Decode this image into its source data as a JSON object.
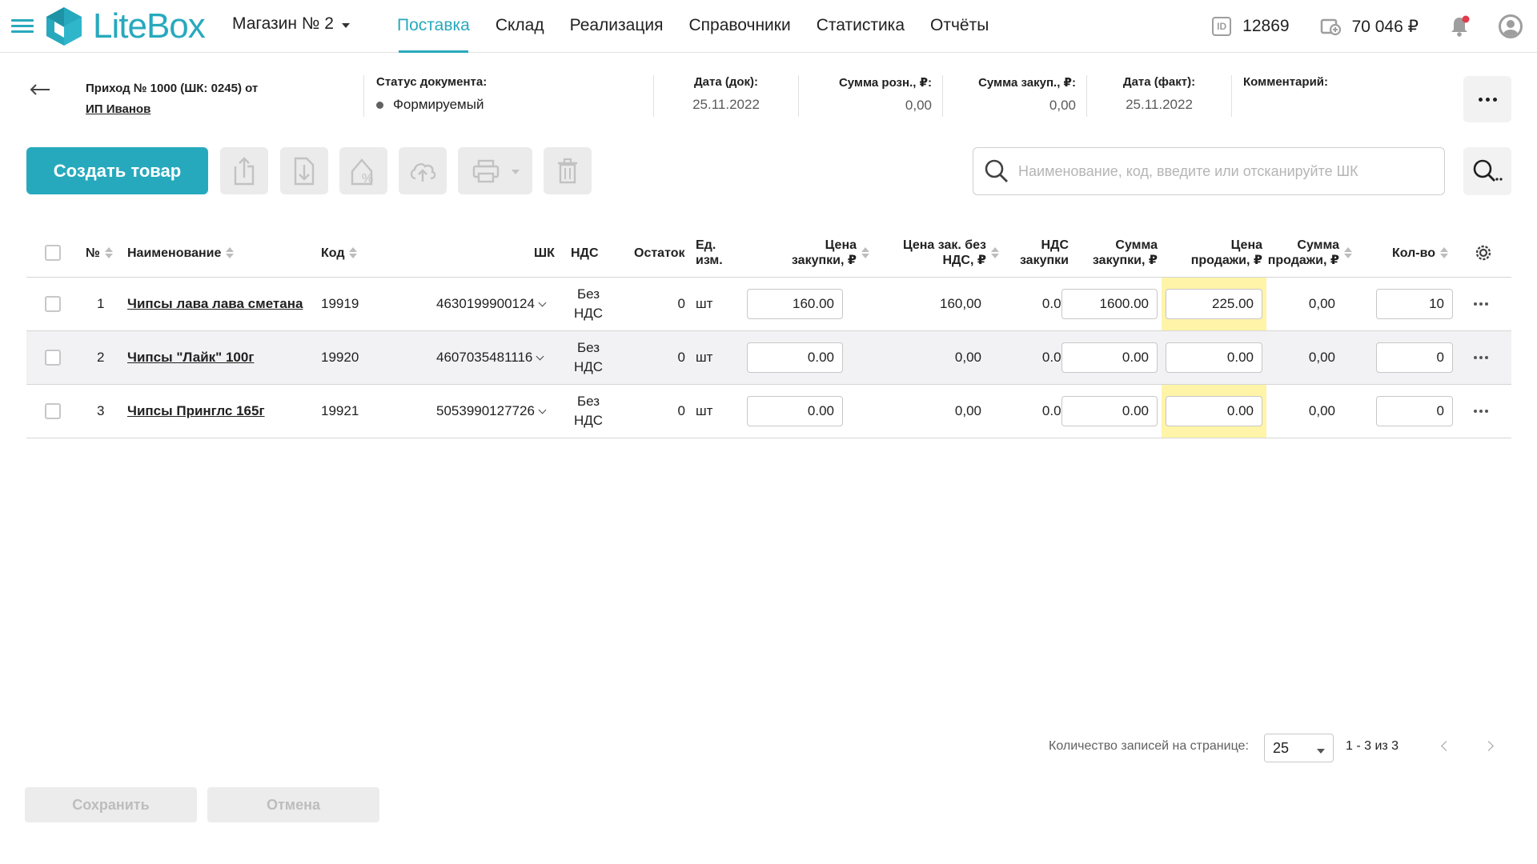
{
  "brand": {
    "name": "LiteBox",
    "color": "#27a9bd"
  },
  "store": {
    "label": "Магазин № 2"
  },
  "nav": [
    {
      "label": "Поставка",
      "active": true
    },
    {
      "label": "Склад"
    },
    {
      "label": "Реализация"
    },
    {
      "label": "Справочники"
    },
    {
      "label": "Статистика"
    },
    {
      "label": "Отчёты"
    }
  ],
  "account": {
    "id_value": "12869",
    "balance": "70 046 ₽",
    "id_icon_text": "ID"
  },
  "document": {
    "title": "Приход № 1000 (ШК: 0245) от",
    "supplier": "ИП Иванов",
    "status_label": "Статус документа:",
    "status_value": "Формируемый",
    "date_doc_label": "Дата (док):",
    "date_doc_value": "25.11.2022",
    "sum_retail_label": "Сумма розн., ₽:",
    "sum_retail_value": "0,00",
    "sum_purchase_label": "Сумма закуп., ₽:",
    "sum_purchase_value": "0,00",
    "date_fact_label": "Дата (факт):",
    "date_fact_value": "25.11.2022",
    "comment_label": "Комментарий:"
  },
  "toolbar": {
    "create_label": "Создать товар",
    "search_placeholder": "Наименование, код, введите или отсканируйте ШК"
  },
  "table": {
    "columns": {
      "num": "№",
      "name": "Наименование",
      "code": "Код",
      "barcode": "ШК",
      "vat": "НДС",
      "stock": "Остаток",
      "unit_1": "Ед.",
      "unit_2": "изм.",
      "purchase_price_1": "Цена",
      "purchase_price_2": "закупки, ₽",
      "price_no_vat_1": "Цена зак. без",
      "price_no_vat_2": "НДС, ₽",
      "vat_purchase_1": "НДС",
      "vat_purchase_2": "закупки",
      "purchase_sum_1": "Сумма",
      "purchase_sum_2": "закупки, ₽",
      "sale_price_1": "Цена",
      "sale_price_2": "продажи, ₽",
      "sale_sum_1": "Сумма",
      "sale_sum_2": "продажи, ₽",
      "qty": "Кол-во"
    },
    "rows": [
      {
        "num": "1",
        "name": "Чипсы лава лава сметана",
        "code": "19919",
        "barcode": "4630199900124",
        "vat_1": "Без",
        "vat_2": "НДС",
        "stock": "0",
        "unit": "шт",
        "purchase_price": "160.00",
        "price_no_vat": "160,00",
        "vat_purchase": "0.00",
        "purchase_sum": "1600.00",
        "sale_price": "225.00",
        "sale_sum": "0,00",
        "qty": "10"
      },
      {
        "num": "2",
        "name": "Чипсы \"Лайк\" 100г",
        "code": "19920",
        "barcode": "4607035481116",
        "vat_1": "Без",
        "vat_2": "НДС",
        "stock": "0",
        "unit": "шт",
        "purchase_price": "0.00",
        "price_no_vat": "0,00",
        "vat_purchase": "0.00",
        "purchase_sum": "0.00",
        "sale_price": "0.00",
        "sale_sum": "0,00",
        "qty": "0"
      },
      {
        "num": "3",
        "name": "Чипсы Принглс 165г",
        "code": "19921",
        "barcode": "5053990127726",
        "vat_1": "Без",
        "vat_2": "НДС",
        "stock": "0",
        "unit": "шт",
        "purchase_price": "0.00",
        "price_no_vat": "0,00",
        "vat_purchase": "0.00",
        "purchase_sum": "0.00",
        "sale_price": "0.00",
        "sale_sum": "0,00",
        "qty": "0"
      }
    ],
    "highlight_color": "#fff4a8"
  },
  "pagination": {
    "label": "Количество записей на странице:",
    "page_size": "25",
    "range": "1 - 3 из 3"
  },
  "footer": {
    "save_label": "Сохранить",
    "cancel_label": "Отмена"
  }
}
